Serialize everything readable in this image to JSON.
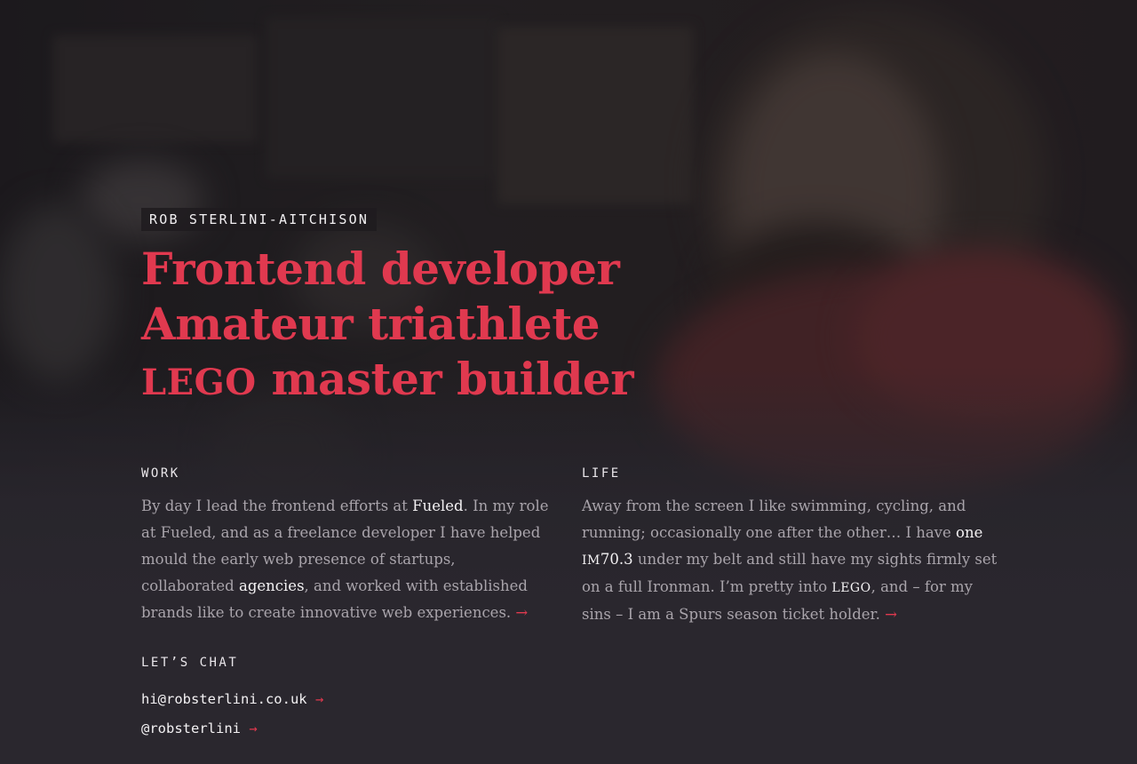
{
  "profile": {
    "name": "ROB STERLINI-AITCHISON",
    "headline": [
      "Frontend developer",
      "Amateur triathlete",
      "LEGO",
      "master builder"
    ]
  },
  "work": {
    "label": "WORK",
    "p1": "By day I lead the frontend efforts at ",
    "link_fueled": "Fueled",
    "p2": ". In my role at Fueled, and as a freelance developer I have helped mould the early web presence of startups, collaborated ",
    "link_agencies": "agencies",
    "p3": ", and worked with established brands like to create innovative web experiences. ",
    "arrow": "→"
  },
  "life": {
    "label": "LIFE",
    "p1": "Away from the screen I like swimming, cycling, and running; occasionally one after the other… I have ",
    "link_one": "one",
    "p2_sc": "IM",
    "link_im": "70.3",
    "p3": " under my belt and still have my sights firmly set on a full Ironman. I’m pretty into ",
    "lego": "LEGO",
    "p4": ", and – for my sins – I am a Spurs season ticket holder. ",
    "arrow": "→"
  },
  "chat": {
    "label": "LET’S CHAT",
    "email": "hi@robsterlini.co.uk",
    "email_arrow": "→",
    "handle": "@robsterlini",
    "handle_arrow": "→"
  },
  "colors": {
    "accent": "#e0394f",
    "background": "#2a272e",
    "text_muted": "#a9a4ab",
    "text_bright": "#f3f1f3"
  }
}
